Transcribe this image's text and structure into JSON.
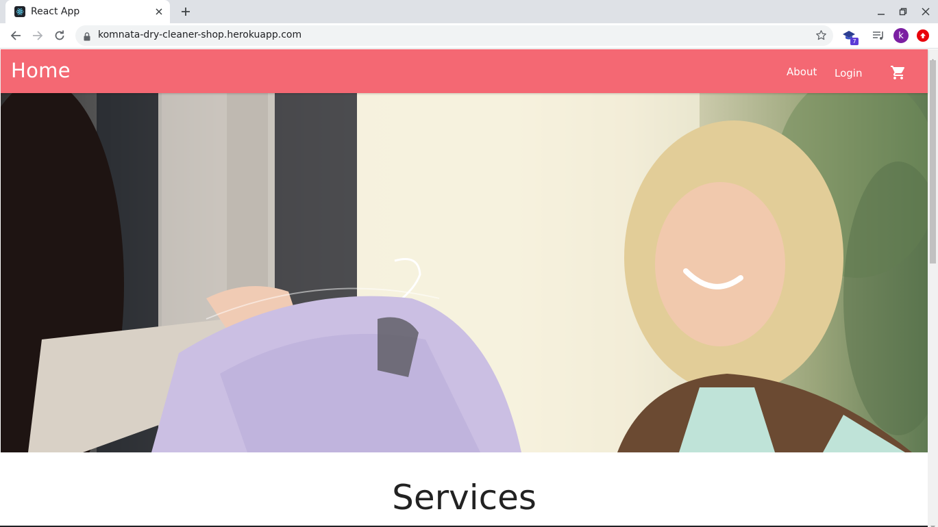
{
  "browser": {
    "tab": {
      "title": "React App",
      "favicon": "react-logo-icon"
    },
    "new_tab_icon": "plus-icon",
    "window_controls": [
      "minimize-icon",
      "restore-icon",
      "close-icon"
    ],
    "url": "komnata-dry-cleaner-shop.herokuapp.com",
    "extension_badge": "7",
    "profile_initial": "k",
    "colors": {
      "tabstrip": "#dee1e6",
      "omnibox": "#f1f3f4",
      "avatar": "#7b1fa2",
      "update": "#e8000b"
    }
  },
  "navbar": {
    "brand": "Home",
    "links": [
      "About",
      "Login"
    ],
    "cart_icon": "shopping-cart-icon",
    "color": "#f46873"
  },
  "hero": {
    "image": "dry-cleaner-customer-receiving-garment-photo"
  },
  "main": {
    "section_title": "Services"
  }
}
